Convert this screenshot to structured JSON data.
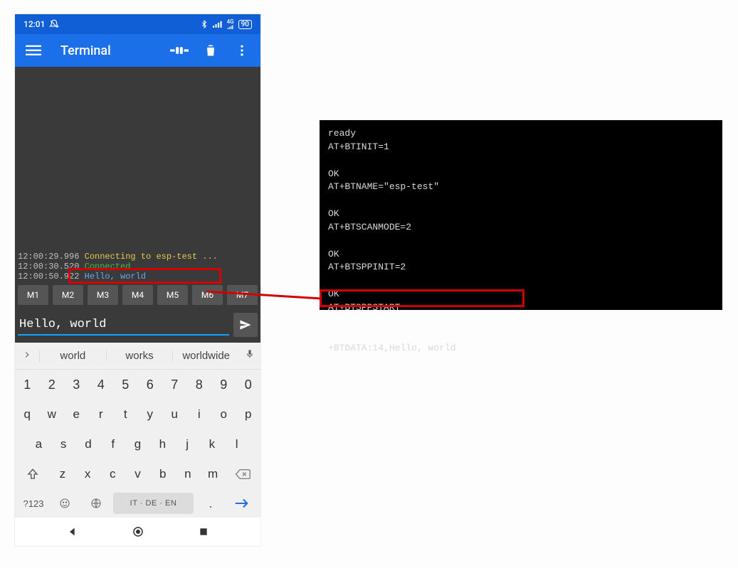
{
  "status": {
    "time": "12:01",
    "battery": "90"
  },
  "app_title": "Terminal",
  "log": {
    "l1_ts": "12:00:29.996 ",
    "l1_msg": "Connecting to esp-test ...",
    "l2_ts": "12:00:30.520 ",
    "l2_msg": "Connected",
    "l3_ts": "12:00:50.922 ",
    "l3_msg": "Hello, world"
  },
  "macros": {
    "m1": "M1",
    "m2": "M2",
    "m3": "M3",
    "m4": "M4",
    "m5": "M5",
    "m6": "M6",
    "m7": "M7"
  },
  "input_value": "Hello, world",
  "suggestions": {
    "s1": "world",
    "s2": "works",
    "s3": "worldwide"
  },
  "keys": {
    "num": [
      "1",
      "2",
      "3",
      "4",
      "5",
      "6",
      "7",
      "8",
      "9",
      "0"
    ],
    "r1": [
      "q",
      "w",
      "e",
      "r",
      "t",
      "y",
      "u",
      "i",
      "o",
      "p"
    ],
    "r2": [
      "a",
      "s",
      "d",
      "f",
      "g",
      "h",
      "j",
      "k",
      "l"
    ],
    "r3": [
      "z",
      "x",
      "c",
      "v",
      "b",
      "n",
      "m"
    ],
    "sym": "?123",
    "space_label": "IT · DE · EN",
    "dot": "."
  },
  "console_text": "ready\nAT+BTINIT=1\n\nOK\nAT+BTNAME=\"esp-test\"\n\nOK\nAT+BTSCANMODE=2\n\nOK\nAT+BTSPPINIT=2\n\nOK\nAT+BTSPPSTART\n\n\n+BTDATA:14,Hello, world"
}
